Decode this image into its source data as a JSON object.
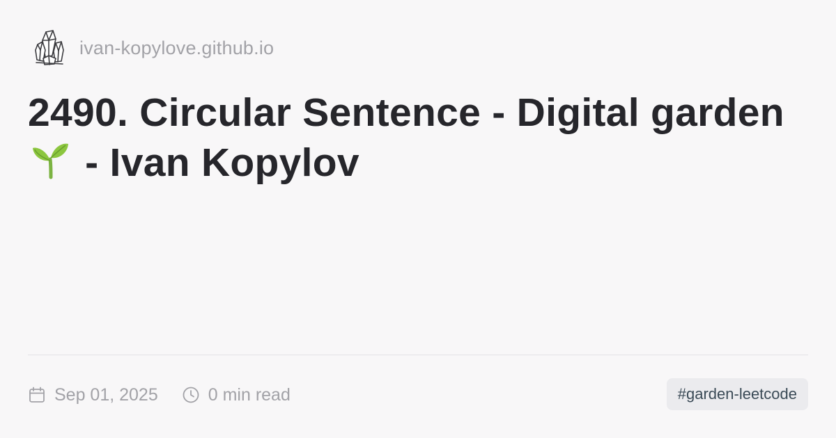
{
  "header": {
    "site_name": "ivan-kopylove.github.io",
    "logo_icon": "crystal-logo-icon"
  },
  "article": {
    "title_part1": "2490. Circular Sentence - Digital garden",
    "title_emoji_icon": "seedling-icon",
    "title_part2": "- Ivan Kopylov"
  },
  "meta": {
    "date_icon": "calendar-icon",
    "date": "Sep 01, 2025",
    "read_icon": "clock-icon",
    "read_time": "0 min read"
  },
  "tags": [
    {
      "label": "#garden-leetcode"
    }
  ],
  "colors": {
    "background": "#f8f7f8",
    "title": "#26262b",
    "muted": "#a2a2a7",
    "tag_bg": "#ebebee",
    "tag_text": "#3a4a56",
    "sprout_green": "#8cc63f"
  }
}
